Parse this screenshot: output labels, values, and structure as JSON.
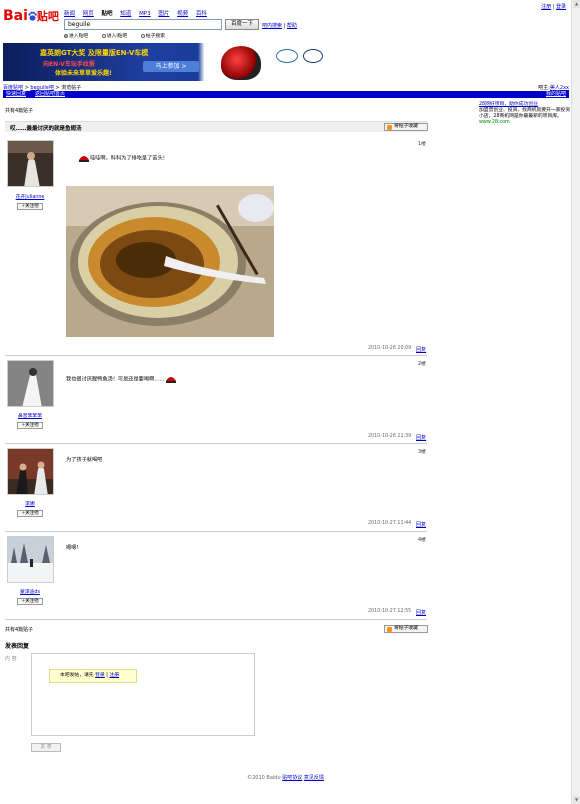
{
  "header": {
    "logo_bai": "Bai",
    "logo_du": "du",
    "logo_tieba": "贴吧",
    "top_links": [
      "注册",
      "登录"
    ],
    "nav": [
      "新闻",
      "网页",
      "贴吧",
      "知道",
      "MP3",
      "图片",
      "视频",
      "百科"
    ],
    "nav_active_index": 2,
    "search_value": "beguile",
    "search_button": "百度一下",
    "search_links": [
      "吧内搜索",
      "帮助"
    ],
    "search_options": [
      "进入贴吧",
      "进入i贴吧",
      "帖子搜索"
    ],
    "search_option_selected": 0
  },
  "banner": {
    "line1": "嘉英朗GT大奖 及限量版EN-V车模",
    "line2": "向EN-V车坛手纹报",
    "line3": "体验未来草草爱乐趣!",
    "cta": "马上参加 >"
  },
  "breadcrumb": {
    "items": [
      "百度贴吧",
      "beguile吧",
      "浏览帖子"
    ],
    "right": "吧主:",
    "right_link": "美人2xx"
  },
  "bluebar": {
    "left_links": [
      "快速回复",
      "返回贴吧首页"
    ],
    "right_link": "我的贴吧"
  },
  "thread": {
    "reply_count": "共有4篇贴子",
    "title": "哎……最最讨厌的就是鱼翅汤",
    "fav_button": "将帖子收藏",
    "posts": [
      {
        "floor": "1楼",
        "user": "花开Julianne",
        "follow": "关注他",
        "text": "哇哇啊，科科为了排吃呈了苦头！",
        "date": "2010-10-26 20:09",
        "reply": "回复"
      },
      {
        "floor": "2楼",
        "user": "鼻音笨笨笨",
        "follow": "关注他",
        "text": "我也很讨厌腥鸭鱼汤！可是还是要喝啊……",
        "date": "2010-10-26 21:39",
        "reply": "回复"
      },
      {
        "floor": "3楼",
        "user": "李娜",
        "follow": "关注他",
        "text": "为了孩子就喝吧",
        "date": "2010-10-27 11:44",
        "reply": "回复"
      },
      {
        "floor": "4楼",
        "user": "蒙泽迪ds",
        "follow": "关注他",
        "text": "嗯嗯!",
        "date": "2010-10-27 12:55",
        "reply": "回复"
      }
    ]
  },
  "bottom": {
    "reply_count": "共有4篇贴子",
    "fav_button": "将帖子收藏"
  },
  "sidead": {
    "title": "28网好项目，助你成功创业",
    "body": "加盟普创业、投资、找商机就要开一家投资小店，28商机网是你最最新的项目库。",
    "url": "www.28.com"
  },
  "reply": {
    "heading": "发表回复",
    "content_label": "内 容",
    "login_prompt": "本吧发帖，请先",
    "login_link": "登录",
    "sep": "|",
    "register_link": "注册",
    "submit": "发 表"
  },
  "footer": {
    "copyright": "©2010 Baidu",
    "links": [
      "贴吧协议",
      "意见反馈"
    ]
  }
}
